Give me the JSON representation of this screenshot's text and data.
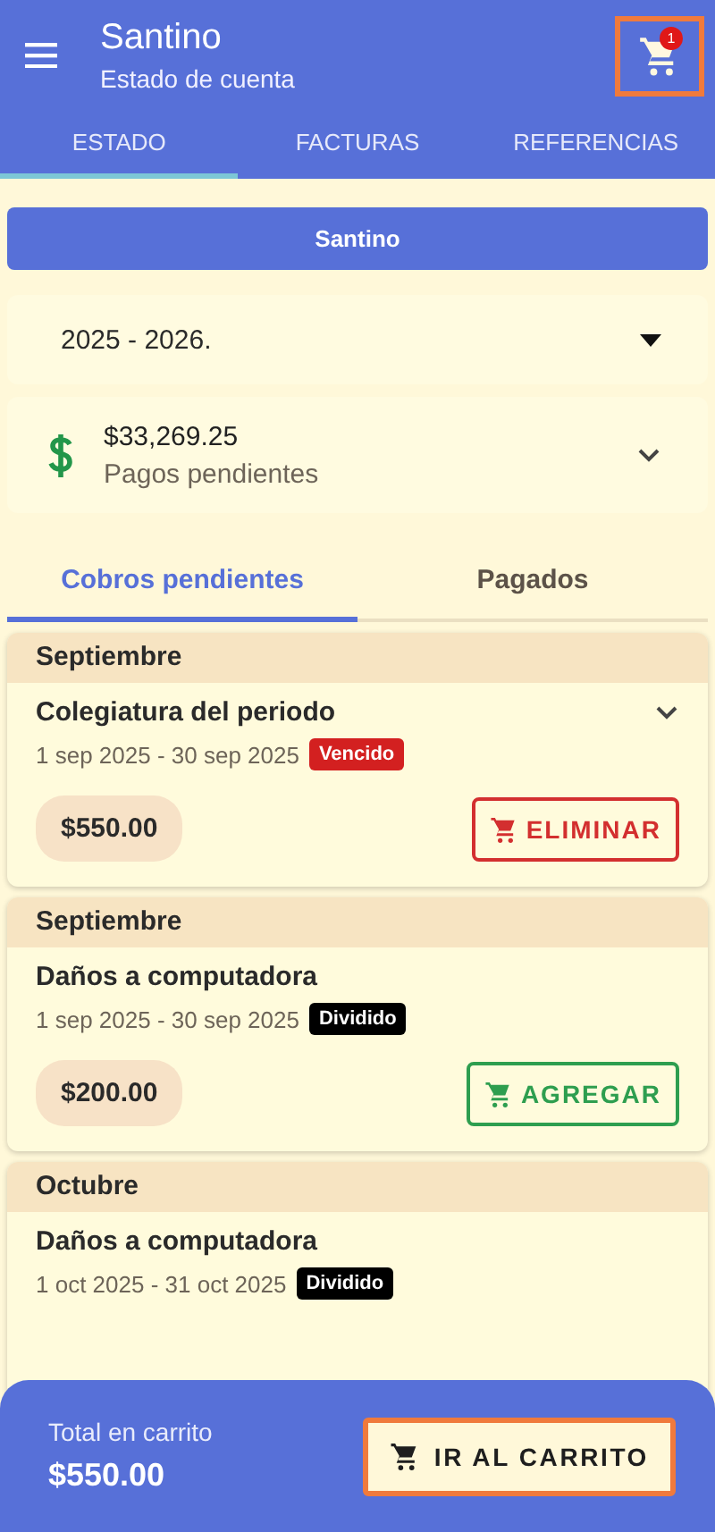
{
  "app_bar": {
    "title": "Santino",
    "subtitle": "Estado de cuenta",
    "cart_badge": "1",
    "cart_highlighted": true
  },
  "tabs": [
    {
      "label": "ESTADO",
      "selected": true
    },
    {
      "label": "FACTURAS",
      "selected": false
    },
    {
      "label": "REFERENCIAS",
      "selected": false
    }
  ],
  "student_button": "Santino",
  "period_select": {
    "value": "2025 - 2026."
  },
  "balance": {
    "amount": "$33,269.25",
    "label": "Pagos pendientes"
  },
  "sub_tabs": [
    {
      "label": "Cobros pendientes",
      "selected": true
    },
    {
      "label": "Pagados",
      "selected": false
    }
  ],
  "charges": [
    {
      "month": "Septiembre",
      "title": "Colegiatura del periodo",
      "dates": "1 sep 2025 - 30 sep 2025",
      "tag": "Vencido",
      "color": "#d32020",
      "expandable": true,
      "price": "$550.00",
      "kind": "remove",
      "action": "ELIMINAR"
    },
    {
      "month": "Septiembre",
      "title": "Daños a computadora",
      "dates": "1 sep 2025 - 30 sep 2025",
      "tag": "Dividido",
      "color": "#000000",
      "expandable": false,
      "price": "$200.00",
      "kind": "add",
      "action": "AGREGAR"
    },
    {
      "month": "Octubre",
      "title": "Daños a computadora",
      "dates": "1 oct 2025 - 31 oct 2025",
      "tag": "Dividido",
      "color": "#000000",
      "expandable": false
    }
  ],
  "cart_bar": {
    "label": "Total en carrito",
    "total": "$550.00",
    "button": "IR AL CARRITO",
    "button_highlighted": true
  }
}
